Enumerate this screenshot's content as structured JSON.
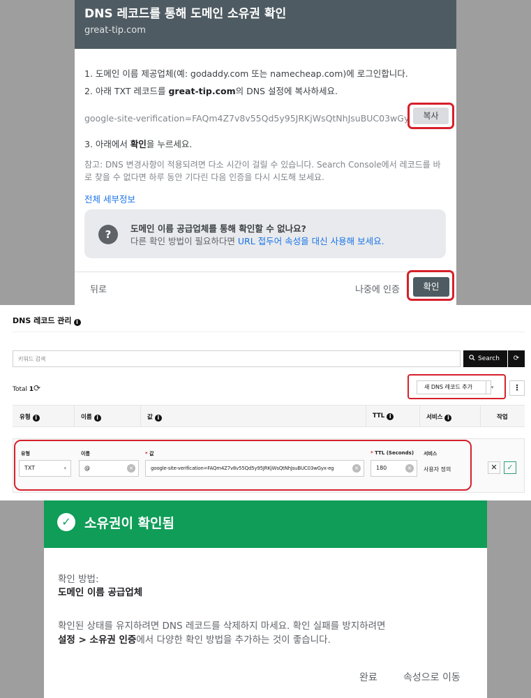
{
  "verify_dialog": {
    "title": "DNS 레코드를 통해 도메인 소유권 확인",
    "domain": "great-tip.com",
    "step1": "1. 도메인 이름 제공업체(예: godaddy.com 또는 namecheap.com)에 로그인합니다.",
    "step2_prefix": "2. 아래 TXT 레코드를 ",
    "step2_domain": "great-tip.com",
    "step2_suffix": "의 DNS 설정에 복사하세요.",
    "txt_record": "google-site-verification=FAQm4Z7v8v55Qd5y95JRKjWsQtNhJsuBUC03wGyx-eg",
    "copy_label": "복사",
    "step3_prefix": "3. 아래에서 ",
    "step3_bold": "확인",
    "step3_suffix": "을 누르세요.",
    "note": "참고: DNS 변경사항이 적용되려면 다소 시간이 걸릴 수 있습니다. Search Console에서 레코드를 바로 찾을 수 없다면 하루 동안 기다린 다음 인증을 다시 시도해 보세요.",
    "detail_link": "전체 세부정보",
    "help_icon": "?",
    "help_title": "도메인 이름 공급업체를 통해 확인할 수 없나요?",
    "help_prefix": "다른 확인 방법이 필요하다면 ",
    "help_link": "URL 접두어 속성을 대신 사용해 보세요.",
    "back_label": "뒤로",
    "later_label": "나중에 인증",
    "confirm_label": "확인"
  },
  "dns_manager": {
    "title": "DNS 레코드 관리",
    "search_placeholder": "키워드 검색",
    "search_label": "Search",
    "total_label": "Total",
    "total_count": "1",
    "add_record_label": "새 DNS 레코드 추가",
    "columns": {
      "type": "유형",
      "name": "이름",
      "value": "값",
      "ttl": "TTL",
      "service": "서비스",
      "action": "작업"
    },
    "edit_row": {
      "type_label": "유형",
      "type_value": "TXT",
      "name_label": "이름",
      "name_value": "@",
      "value_label": "값",
      "value_value": "google-site-verification=FAQm4Z7v8v55Qd5y95JRKjWsQtNhJsuBUC03wGyx-eg",
      "ttl_label": "TTL (Seconds)",
      "ttl_value": "180",
      "service_label": "서비스",
      "service_value": "사용자 정의"
    }
  },
  "success_dialog": {
    "title": "소유권이 확인됨",
    "method_label": "확인 방법:",
    "method_value": "도메인 이름 공급업체",
    "warn_text": "확인된 상태를 유지하려면 DNS 레코드를 삭제하지 마세요. 확인 실패를 방지하려면",
    "warn_bold": "설정 > 소유권 인증",
    "warn_suffix": "에서 다양한 확인 방법을 추가하는 것이 좋습니다.",
    "done_label": "완료",
    "goto_label": "속성으로 이동"
  },
  "colors": {
    "header_slate": "#4f5b62",
    "success_green": "#0f9d58",
    "highlight_red": "#d6202a",
    "link_blue": "#1a73e8"
  }
}
